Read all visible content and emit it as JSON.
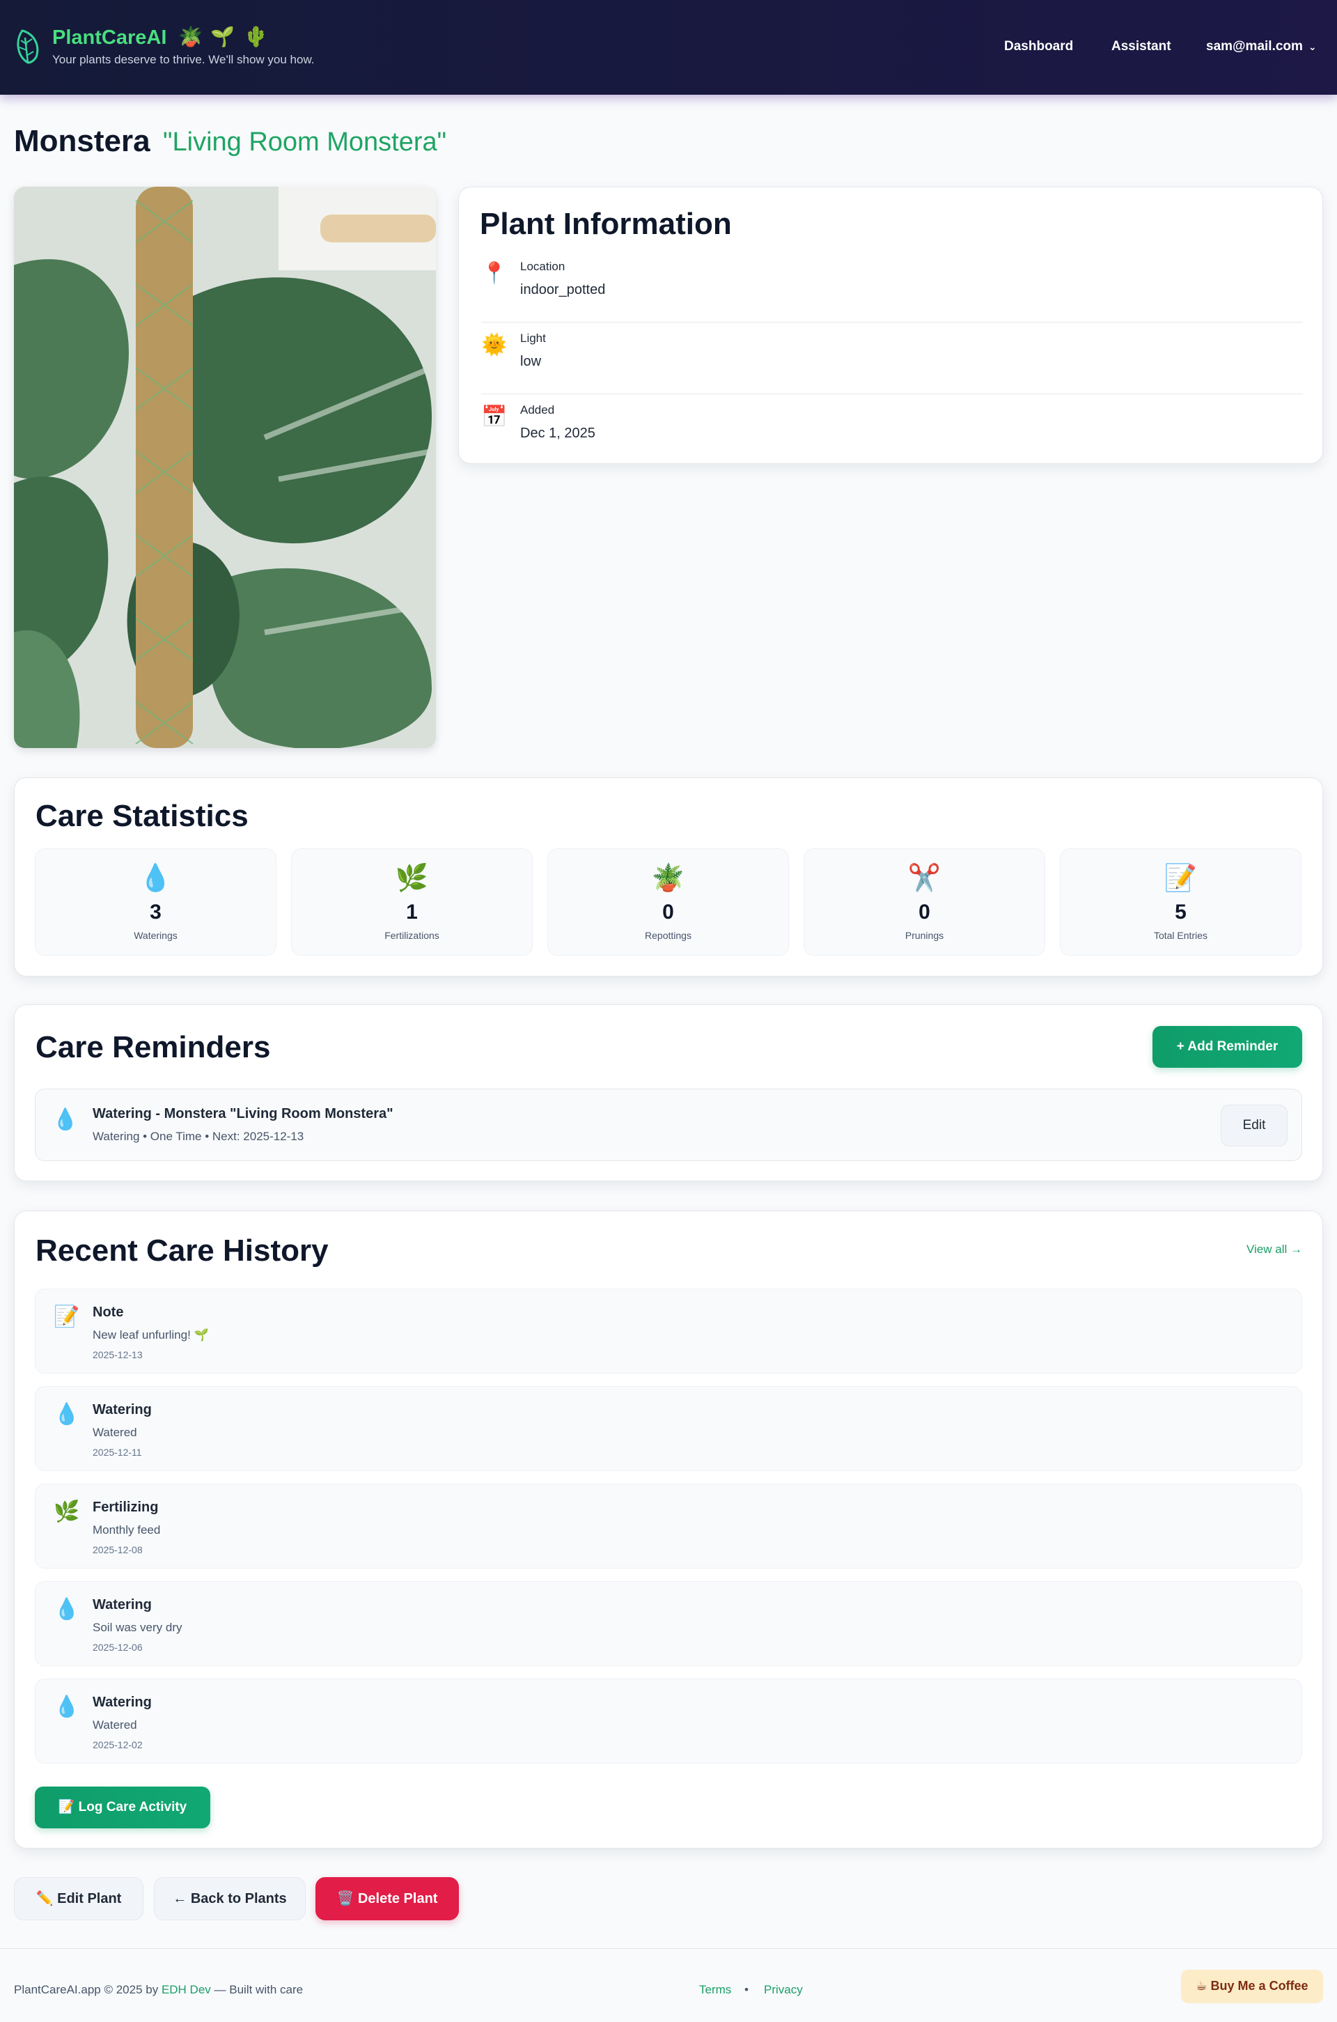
{
  "header": {
    "app_name": "PlantCareAI",
    "emojis": [
      "🪴",
      "🌱",
      "🌵"
    ],
    "tagline": "Your plants deserve to thrive. We'll show you how.",
    "nav": {
      "dashboard": "Dashboard",
      "assistant": "Assistant",
      "account": "sam@mail.com",
      "account_caret": "⌄"
    }
  },
  "plant": {
    "name": "Monstera",
    "nickname": "\"Living Room Monstera\""
  },
  "info": {
    "title": "Plant Information",
    "rows": [
      {
        "icon": "📍",
        "icon_name": "pin-icon",
        "label": "Location",
        "value": "indoor_potted"
      },
      {
        "icon": "🌞",
        "icon_name": "sun-icon",
        "label": "Light",
        "value": "low"
      },
      {
        "icon": "📅",
        "icon_name": "calendar-icon",
        "label": "Added",
        "value": "Dec 1, 2025"
      }
    ]
  },
  "stats": {
    "title": "Care Statistics",
    "items": [
      {
        "icon": "💧",
        "icon_name": "water-drop-icon",
        "value": "3",
        "label": "Waterings"
      },
      {
        "icon": "🌿",
        "icon_name": "herb-icon",
        "value": "1",
        "label": "Fertilizations"
      },
      {
        "icon": "🪴",
        "icon_name": "potted-plant-icon",
        "value": "0",
        "label": "Repottings"
      },
      {
        "icon": "✂️",
        "icon_name": "scissors-icon",
        "value": "0",
        "label": "Prunings"
      },
      {
        "icon": "📝",
        "icon_name": "memo-icon",
        "value": "5",
        "label": "Total Entries"
      }
    ]
  },
  "reminders": {
    "title": "Care Reminders",
    "add_label": "+ Add Reminder",
    "items": [
      {
        "icon": "💧",
        "title": "Watering - Monstera \"Living Room Monstera\"",
        "meta": "Watering  •  One Time  •  Next: 2025-12-13",
        "edit": "Edit"
      }
    ]
  },
  "history": {
    "title": "Recent Care History",
    "view_all": "View all →",
    "entries": [
      {
        "icon": "📝",
        "icon_name": "memo-icon",
        "type": "Note",
        "note": "New leaf unfurling! 🌱",
        "date": "2025-12-13"
      },
      {
        "icon": "💧",
        "icon_name": "water-drop-icon",
        "type": "Watering",
        "note": "Watered",
        "date": "2025-12-11"
      },
      {
        "icon": "🌿",
        "icon_name": "herb-icon",
        "type": "Fertilizing",
        "note": "Monthly feed",
        "date": "2025-12-08"
      },
      {
        "icon": "💧",
        "icon_name": "water-drop-icon",
        "type": "Watering",
        "note": "Soil was very dry",
        "date": "2025-12-06"
      },
      {
        "icon": "💧",
        "icon_name": "water-drop-icon",
        "type": "Watering",
        "note": "Watered",
        "date": "2025-12-02"
      }
    ],
    "log_label": "📝  Log Care Activity"
  },
  "actions": {
    "edit": "✏️  Edit Plant",
    "back": "←  Back to Plants",
    "delete": "🗑️  Delete Plant"
  },
  "footer": {
    "copyright": "PlantCareAI.app © 2025 by ",
    "author": "EDH Dev",
    "sep": " — ",
    "built": "Built with care",
    "terms": "Terms",
    "dot": "•",
    "privacy": "Privacy",
    "coffee": "☕ Buy Me a Coffee"
  },
  "colors": {
    "header_bg": "#141a38",
    "brand_green": "#4ade80",
    "accent_green": "#0f9d6a",
    "delete_red": "#e11d48"
  }
}
